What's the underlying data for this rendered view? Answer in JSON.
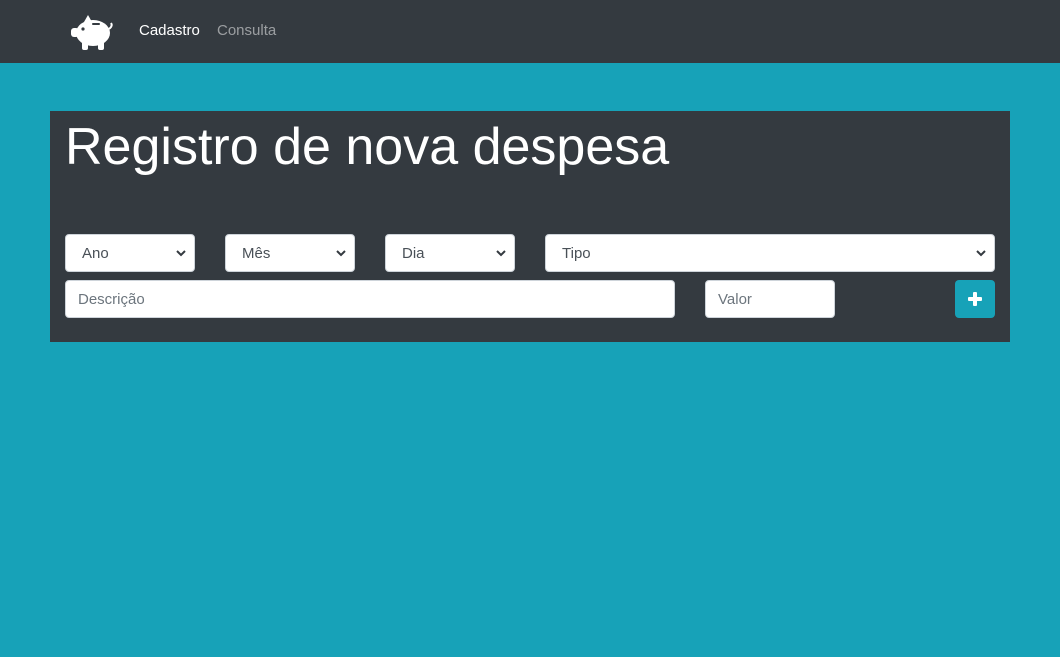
{
  "navbar": {
    "brand_icon": "piggy-bank-icon",
    "links": [
      {
        "label": "Cadastro",
        "active": true
      },
      {
        "label": "Consulta",
        "active": false
      }
    ]
  },
  "form": {
    "title": "Registro de nova despesa",
    "selects": {
      "ano": "Ano",
      "mes": "Mês",
      "dia": "Dia",
      "tipo": "Tipo"
    },
    "descricao_placeholder": "Descrição",
    "valor_placeholder": "Valor",
    "add_button_icon": "plus-icon"
  },
  "colors": {
    "background": "#17a2b8",
    "navbar": "#343a40",
    "panel": "#343a40",
    "accent": "#17a2b8"
  }
}
